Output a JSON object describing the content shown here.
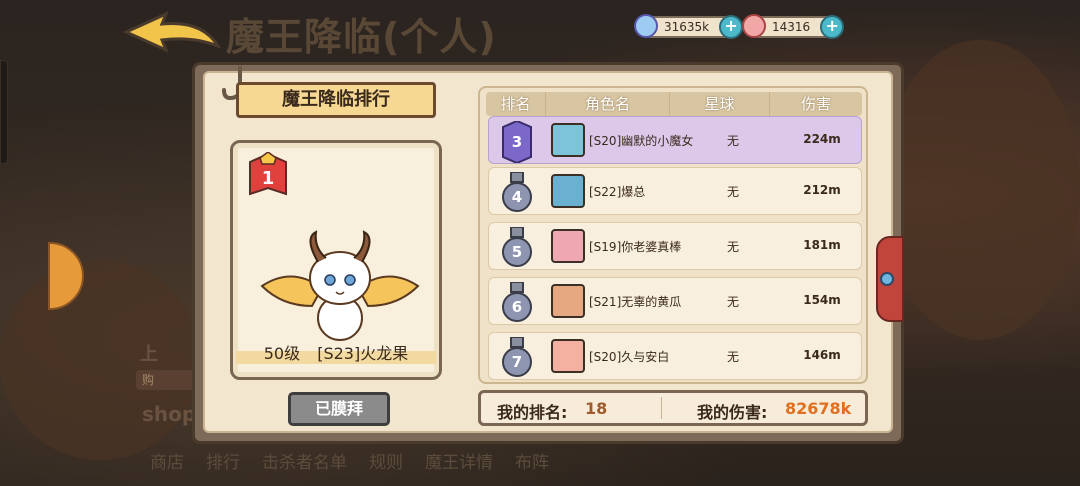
{
  "header": {
    "title": "魔王降临(个人)"
  },
  "currencies": [
    {
      "icon": "potion-blue-icon",
      "value": "31635k"
    },
    {
      "icon": "potion-red-icon",
      "value": "14316"
    }
  ],
  "panel": {
    "title": "魔王降临排行",
    "top_player": {
      "rank": "1",
      "level": "50级",
      "name": "[S23]火龙果"
    },
    "worship_button": "已膜拜"
  },
  "list": {
    "columns": [
      "排名",
      "角色名",
      "星球",
      "伤害"
    ],
    "rows": [
      {
        "rank": "3",
        "name": "[S20]幽默的小魔女",
        "planet": "无",
        "damage": "224m"
      },
      {
        "rank": "4",
        "name": "[S22]爆总",
        "planet": "无",
        "damage": "212m"
      },
      {
        "rank": "5",
        "name": "[S19]你老婆真棒",
        "planet": "无",
        "damage": "181m"
      },
      {
        "rank": "6",
        "name": "[S21]无辜的黄瓜",
        "planet": "无",
        "damage": "154m"
      },
      {
        "rank": "7",
        "name": "[S20]久与安白",
        "planet": "无",
        "damage": "146m"
      }
    ]
  },
  "footer": {
    "my_rank_label": "我的排名:",
    "my_rank_value": "18",
    "my_damage_label": "我的伤害:",
    "my_damage_value": "82678k"
  },
  "bottom_nav": [
    "商店",
    "排行",
    "击杀者名单",
    "规则",
    "魔王详情",
    "布阵"
  ],
  "colors": {
    "accent": "#e07020",
    "highlight_row": "#dcc9ea",
    "panel_bg": "#f2e6cf"
  }
}
